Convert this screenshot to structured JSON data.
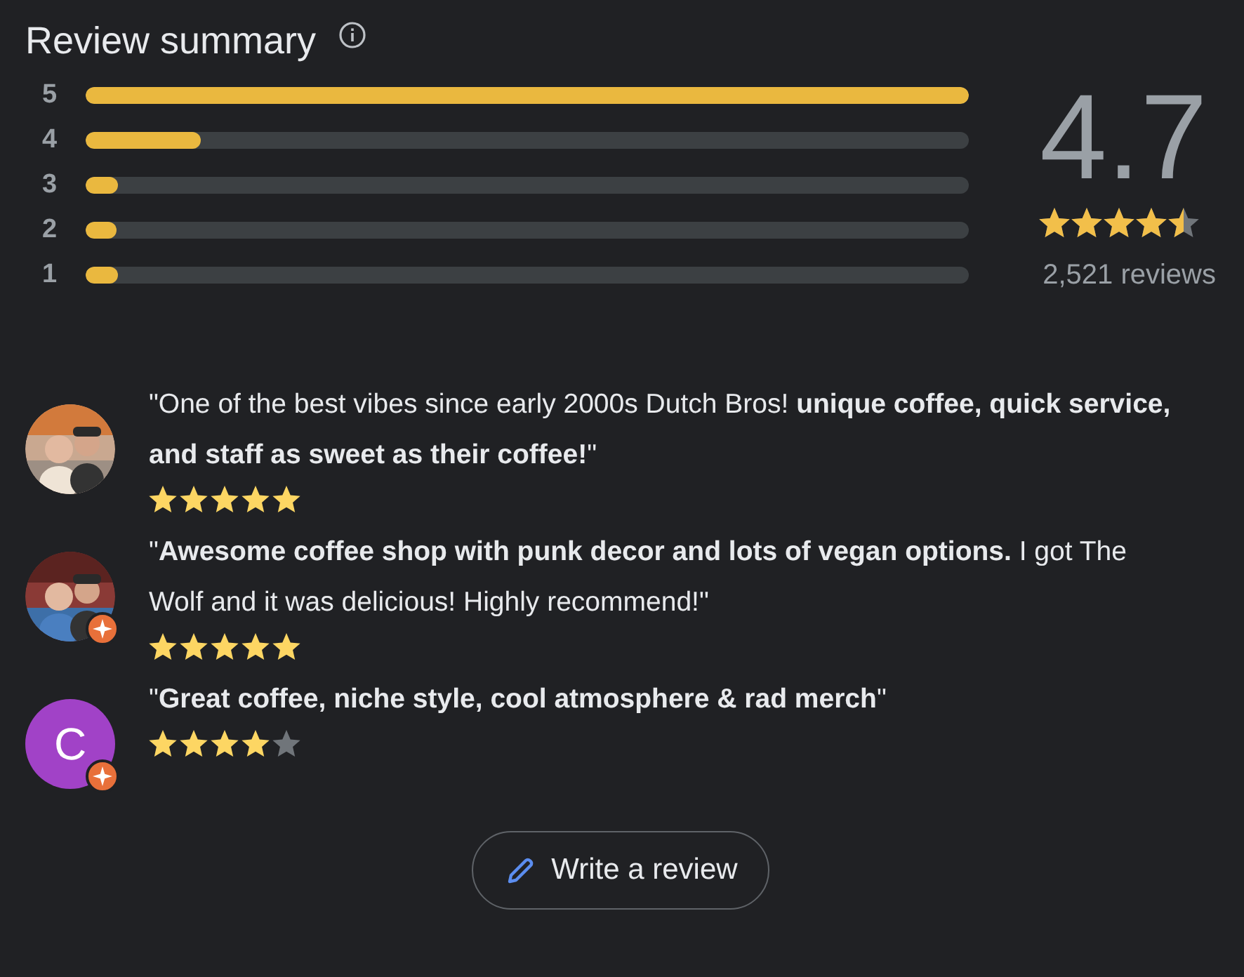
{
  "title": "Review summary",
  "distribution": [
    {
      "label": "5",
      "level": 1.0
    },
    {
      "label": "4",
      "level": 0.13
    },
    {
      "label": "3",
      "level": 0.037
    },
    {
      "label": "2",
      "level": 0.02
    },
    {
      "label": "1",
      "level": 0.037
    }
  ],
  "rating": {
    "value": "4.7",
    "stars": 4.5,
    "count": "2,521 reviews"
  },
  "reviews": [
    {
      "avatar": {
        "kind": "picture",
        "local_guide": false
      },
      "text": "\"One of the best vibes since early 2000s Dutch Bros! **unique coffee, quick service, and staff as sweet as their coffee!**\"",
      "stars": 5
    },
    {
      "avatar": {
        "kind": "picture",
        "local_guide": true
      },
      "text": "\"**Awesome coffee shop with punk decor and lots of vegan options.** I got The Wolf and it was delicious! Highly recommend!\"",
      "stars": 5
    },
    {
      "avatar": {
        "kind": "letter",
        "letter": "C",
        "color": "#a142c7",
        "local_guide": true
      },
      "text": "\"**Great coffee, niche style, cool atmosphere & rad merch**\"",
      "stars": 4
    }
  ],
  "write_button": {
    "label": "Write a review"
  }
}
